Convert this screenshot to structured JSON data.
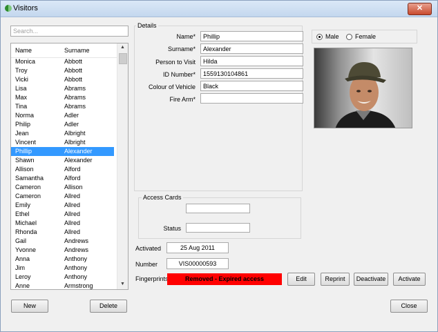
{
  "window": {
    "title": "Visitors",
    "close_glyph": "✕"
  },
  "search": {
    "placeholder": "Search...",
    "value": ""
  },
  "list": {
    "headers": {
      "name": "Name",
      "surname": "Surname"
    },
    "selected_index": 10,
    "rows": [
      {
        "name": "Monica",
        "surname": "Abbott"
      },
      {
        "name": "Troy",
        "surname": "Abbott"
      },
      {
        "name": "Vicki",
        "surname": "Abbott"
      },
      {
        "name": "Lisa",
        "surname": "Abrams"
      },
      {
        "name": "Max",
        "surname": "Abrams"
      },
      {
        "name": "Tina",
        "surname": "Abrams"
      },
      {
        "name": "Norma",
        "surname": "Adler"
      },
      {
        "name": "Philip",
        "surname": "Adler"
      },
      {
        "name": "Jean",
        "surname": "Albright"
      },
      {
        "name": "Vincent",
        "surname": "Albright"
      },
      {
        "name": "Phillip",
        "surname": "Alexander"
      },
      {
        "name": "Shawn",
        "surname": "Alexander"
      },
      {
        "name": "Allison",
        "surname": "Alford"
      },
      {
        "name": "Samantha",
        "surname": "Alford"
      },
      {
        "name": "Cameron",
        "surname": "Allison"
      },
      {
        "name": "Cameron",
        "surname": "Allred"
      },
      {
        "name": "Emily",
        "surname": "Allred"
      },
      {
        "name": "Ethel",
        "surname": "Allred"
      },
      {
        "name": "Michael",
        "surname": "Allred"
      },
      {
        "name": "Rhonda",
        "surname": "Allred"
      },
      {
        "name": "Gail",
        "surname": "Andrews"
      },
      {
        "name": "Yvonne",
        "surname": "Andrews"
      },
      {
        "name": "Anna",
        "surname": "Anthony"
      },
      {
        "name": "Jim",
        "surname": "Anthony"
      },
      {
        "name": "Leroy",
        "surname": "Anthony"
      },
      {
        "name": "Anne",
        "surname": "Armstrong"
      }
    ]
  },
  "scroll": {
    "up": "▲",
    "down": "▼"
  },
  "details": {
    "group_label": "Details",
    "name_label": "Name*",
    "name_value": "Phillip",
    "surname_label": "Surname*",
    "surname_value": "Alexander",
    "visit_label": "Person to Visit",
    "visit_value": "Hilda",
    "id_label": "ID Number*",
    "id_value": "1559130104861",
    "vehicle_label": "Colour of Vehicle",
    "vehicle_value": "Black",
    "firearm_label": "Fire Arm*",
    "firearm_value": ""
  },
  "gender": {
    "male_label": "Male",
    "female_label": "Female",
    "selected": "Male"
  },
  "access_cards": {
    "group_label": "Access Cards",
    "card_value": "",
    "status_label": "Status",
    "status_value": ""
  },
  "activated": {
    "label": "Activated",
    "value": "25 Aug 2011"
  },
  "number": {
    "label": "Number",
    "value": "VIS00000593"
  },
  "fingerprints": {
    "label": "Fingerprints",
    "status": "Removed - Expired access",
    "status_color": "#ff0000"
  },
  "buttons": {
    "edit": "Edit",
    "reprint": "Reprint",
    "deactivate": "Deactivate",
    "activate": "Activate",
    "new": "New",
    "delete": "Delete",
    "close": "Close"
  },
  "colors": {
    "selection": "#3399ff",
    "titlebar": "#c3d7ee",
    "close_button": "#c84a2e"
  }
}
